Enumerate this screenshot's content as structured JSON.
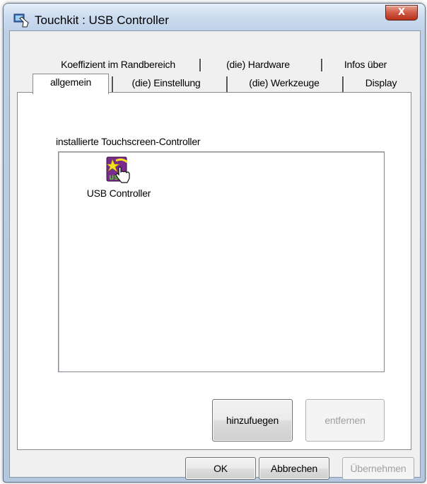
{
  "window": {
    "title": "Touchkit : USB Controller",
    "close_label": "X"
  },
  "tabs": {
    "row_back": [
      {
        "label": "Koeffizient im Randbereich"
      },
      {
        "label": "(die) Hardware"
      },
      {
        "label": "Infos über"
      }
    ],
    "row_front": [
      {
        "label": "allgemein",
        "active": true
      },
      {
        "label": "(die) Einstellung"
      },
      {
        "label": "(die) Werkzeuge"
      },
      {
        "label": "Display"
      }
    ]
  },
  "panel": {
    "group_label": "installierte Touchscreen-Controller",
    "controllers": [
      {
        "label": "USB Controller",
        "icon": "usb-controller-icon",
        "icon_text": "USB"
      }
    ],
    "add_button": "hinzufuegen",
    "remove_button": "entfernen"
  },
  "footer": {
    "ok": "OK",
    "cancel": "Abbrechen",
    "apply": "Übernehmen"
  },
  "colors": {
    "icon_purple": "#7a2a8c",
    "icon_green": "#4fd21a",
    "icon_yellow": "#f4e31c"
  }
}
